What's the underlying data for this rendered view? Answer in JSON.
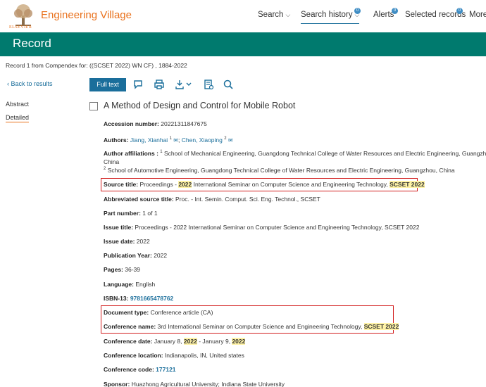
{
  "header": {
    "logo_caption": "ELSEVIER",
    "brand": "Engineering Village",
    "nav": {
      "search": "Search",
      "search_history": "Search history",
      "alerts": "Alerts",
      "selected_records": "Selected records",
      "more": "More"
    },
    "badges": {
      "history": "0",
      "alerts": "0",
      "selected": "0"
    }
  },
  "page_title": "Record",
  "record_line": "Record 1 from Compendex for: ((SCSET 2022) WN CF) , 1884-2022",
  "toolbar": {
    "back": "Back to results",
    "full_text": "Full text"
  },
  "sidebar": {
    "abstract": "Abstract",
    "detailed": "Detailed"
  },
  "record": {
    "title": "A Method of Design and Control for Mobile Robot",
    "accession_label": "Accession number:",
    "accession_value": "20221311847675",
    "authors_label": "Authors:",
    "author1": "Jiang, Xianhai",
    "author1_sup": "1",
    "author2": "Chen, Xiaoping",
    "author2_sup": "2",
    "affil_label": "Author affiliations :",
    "affil1_sup": "1",
    "affil1_line1": "School of Mechanical Engineering, Guangdong Technical College of Water Resources and Electric Engineering, Guangzhou,",
    "affil1_line2": "China",
    "affil2_sup": "2",
    "affil2": "School of Automotive Engineering, Guangdong Technical College of Water Resources and Electric Engineering, Guangzhou, China",
    "source_label": "Source title:",
    "source_pre": "Proceedings -",
    "source_year": "2022",
    "source_mid": "International Seminar on Computer Science and Engineering Technology,",
    "source_hl": "SCSET 2022",
    "abbr_label": "Abbreviated source title:",
    "abbr_value": "Proc. - Int. Semin. Comput. Sci. Eng. Technol., SCSET",
    "part_label": "Part number:",
    "part_value": "1 of 1",
    "issue_title_label": "Issue title:",
    "issue_title_value": "Proceedings - 2022 International Seminar on Computer Science and Engineering Technology, SCSET 2022",
    "issue_date_label": "Issue date:",
    "issue_date_value": "2022",
    "pub_year_label": "Publication Year:",
    "pub_year_value": "2022",
    "pages_label": "Pages:",
    "pages_value": "36-39",
    "language_label": "Language:",
    "language_value": "English",
    "isbn_label": "ISBN-13:",
    "isbn_value": "9781665478762",
    "doctype_label": "Document type:",
    "doctype_value": "Conference article (CA)",
    "conf_name_label": "Conference name:",
    "conf_name_value": "3rd International Seminar on Computer Science and Engineering Technology,",
    "conf_name_hl": "SCSET 2022",
    "conf_date_label": "Conference date:",
    "conf_date_pre": "January 8,",
    "conf_date_y1": "2022",
    "conf_date_mid": "- January 9,",
    "conf_date_y2": "2022",
    "conf_loc_label": "Conference location:",
    "conf_loc_value": "Indianapolis, IN, United states",
    "conf_code_label": "Conference code:",
    "conf_code_value": "177121",
    "sponsor_label": "Sponsor:",
    "sponsor_value": "Huazhong Agricultural University; Indiana State University"
  },
  "colors": {
    "brand_orange": "#e9711c",
    "green": "#007a6e",
    "blue": "#1a6e9b",
    "highlight": "#fff3a6",
    "annotation_red": "#d21e1e"
  },
  "icons": [
    "elsevier-tree-logo",
    "comment-icon",
    "print-icon",
    "download-icon",
    "citation-icon",
    "search-icon",
    "mail-icon"
  ]
}
